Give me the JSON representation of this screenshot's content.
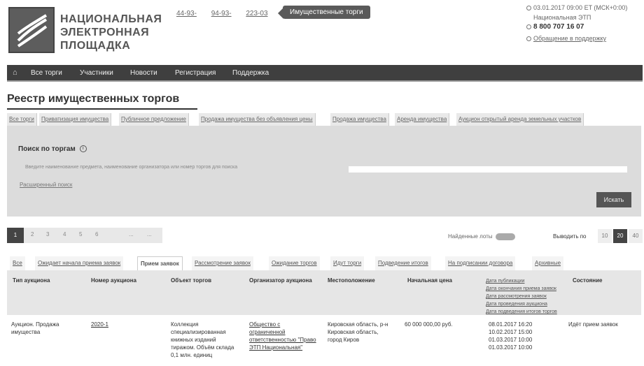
{
  "header": {
    "logo_lines": [
      "НАЦИОНАЛЬНАЯ",
      "ЭЛЕКТРОННАЯ",
      "ПЛОЩАДКА"
    ],
    "phones": [
      "44-93-",
      "94-93-",
      "223-03"
    ],
    "top_tab": "Имущественные торги",
    "contact": {
      "datetime": "03.01.2017 09:00 ET (МСК+0:00)",
      "label": "Национальная ЭТП",
      "phone": "8 800 707 16 07",
      "feedback": "Обращение в поддержку"
    }
  },
  "nav": {
    "items": [
      "Все торги",
      "Участники",
      "Новости",
      "Регистрация",
      "Поддержка"
    ]
  },
  "page_title": "Реестр имущественных торгов",
  "categories": [
    "Все торги",
    "Приватизация имущества",
    "Публичное предложение",
    "Продажа имущества без объявления цены",
    "Продажа имущества",
    "Аренда имущества",
    "Аукцион открытый аренда земельных участков"
  ],
  "search": {
    "title": "Поиск по торгам",
    "hint": "Введите наименование предмета, наименование организатора или номер торгов для поиска",
    "input_placeholder": "",
    "extended": "Расширенный поиск",
    "button": "Искать"
  },
  "pager": {
    "pages": [
      "1",
      "2",
      "3",
      "4",
      "5",
      "6",
      "...",
      "..."
    ],
    "found_label": "Найденные лоты",
    "found_count": "",
    "per_page_label": "Выводить по",
    "per_page_options": [
      "10",
      "20",
      "40"
    ],
    "per_page_active": "20"
  },
  "status_tabs": [
    "Все",
    "Ожидает начала приема заявок",
    "Прием заявок",
    "Рассмотрение заявок",
    "Ожидание торгов",
    "Идут торги",
    "Подведение итогов",
    "На подписании договора",
    "Архивные"
  ],
  "status_tab_active": "Прием заявок",
  "table": {
    "columns": [
      "Тип аукциона",
      "Номер аукциона",
      "Объект торгов",
      "Организатор аукциона",
      "Местоположение",
      "Начальная цена",
      "Дата публикации",
      "Состояние"
    ],
    "date_sublabels": [
      "Дата публикации",
      "Дата окончания приема заявок",
      "Дата рассмотрения заявок",
      "Дата проведения аукциона",
      "Дата подведения итогов торгов"
    ],
    "rows": [
      {
        "type": [
          "Аукцион. Продажа",
          "имущества"
        ],
        "number": "2020-1",
        "object": [
          "Коллекция",
          "специализированная",
          "книжных изданий",
          "тиражом. Объём склада",
          "0,1 млн. единиц"
        ],
        "organizer": [
          "Общество с",
          "ограниченной",
          "ответственностью \"Право",
          "ЭТП Национальная\""
        ],
        "location": [
          "Кировская область, р-н",
          "Кировская область,",
          "город Киров"
        ],
        "price": "60 000 000,00 руб.",
        "dates": [
          "08.01.2017 16:20",
          "10.02.2017 15:00",
          "01.03.2017 10:00",
          "01.03.2017 10:00"
        ],
        "status": "Идёт прием заявок"
      }
    ]
  }
}
